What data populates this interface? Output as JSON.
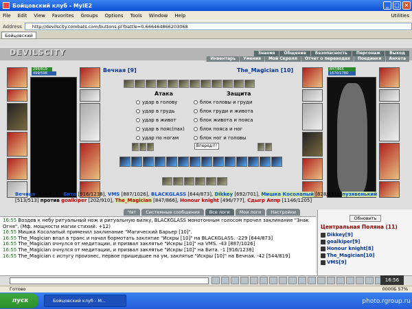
{
  "window": {
    "title": "Бойцовский клуб - MyIE2"
  },
  "menu": {
    "items": [
      "File",
      "Edit",
      "View",
      "Favorites",
      "Groups",
      "Options",
      "Tools",
      "Window",
      "Help"
    ],
    "utilities": "Utilities"
  },
  "address": {
    "label": "Address",
    "url": "http://devilscity.combats.com/buttons.pl?battle=0.666464866203068"
  },
  "tab": {
    "label": "Бойцовский"
  },
  "game": {
    "logo": "DEVILSCITY",
    "nav_top": [
      "Знания",
      "Общение",
      "Безопасность",
      "Персонаж",
      "Выход"
    ],
    "nav_bottom": [
      "Инвентарь",
      "Умения",
      "Мой Скролл",
      "Отчет о переводах",
      "Поединки",
      "Анкета"
    ],
    "left": {
      "name": "Вечная [9]",
      "hp": "294/819",
      "mana": "499/598"
    },
    "right": {
      "name": "The_Magician [10]",
      "hp": "847/866",
      "mana": "1670/1780"
    },
    "attack_header": "Атака",
    "defense_header": "Защита",
    "attacks": [
      "удар в голову",
      "удар в грудь",
      "удар в живот",
      "удар в пояс(пах)",
      "удар по ногам"
    ],
    "defenses": [
      "блок головы и груди",
      "блок груди и живота",
      "блок живота и пояса",
      "блок пояса и ног",
      "блок ног и головы"
    ],
    "forward": "Вперед!!!"
  },
  "teams": {
    "left": [
      {
        "name": "Вечная",
        "hp": "[544/819]"
      },
      {
        "name": "Бита",
        "hp": "[916/1238]"
      },
      {
        "name": "VMS",
        "hp": "[887/1026]"
      },
      {
        "name": "BLACKGLASS",
        "hp": "[644/873]"
      },
      {
        "name": "Dikkey",
        "hp": "[692/701]"
      },
      {
        "name": "Мишка Косолапый",
        "hp": "[828/851]"
      },
      {
        "name": "пузявенький",
        "hp": "[513/513]"
      }
    ],
    "vs": "против",
    "right": [
      {
        "name": "goalkiper",
        "hp": "[202/910]"
      },
      {
        "name": "The_Magician",
        "hp": "[847/866]"
      },
      {
        "name": "Honour knight",
        "hp": "[496/777]"
      },
      {
        "name": "Сдыгр Аппр",
        "hp": "[1146/1205]"
      }
    ]
  },
  "chat_tabs": [
    "Чат",
    "Системные сообщения",
    "Все логи",
    "Мои логи",
    "Настройки"
  ],
  "log": [
    {
      "t": "16:55",
      "text": "Воздев к небу ритуальный нож и ритуальную вилку, BLACKGLASS монотонным голосом прочел заклинание \"Знак Огня\". (Мф. мощности магии стихий: +12)"
    },
    {
      "t": "16:55",
      "text": "Мишка Косолапый применил заклинание \"Магический Барьер [10]\"."
    },
    {
      "t": "16:55",
      "text": "The_Magician впал в транс и начал бормотать заклятие \"Искры [10]\" на BLACKGLASS. -229 [644/873]"
    },
    {
      "t": "16:55",
      "text": "The_Magician очнулся от медитации, и призвал заклятье \"Искры [10]\" на VMS. -43 [887/1026]"
    },
    {
      "t": "16:55",
      "text": "The_Magician очнулся от медитации, и призвал заклятье \"Искры [10]\" на Бита. -1 [916/1238]"
    },
    {
      "t": "16:55",
      "text": "The_Magician с испугу произнес, первое пришедшее на ум, заклятье \"Искры [10]\" на Вечная. -42 [544/819]"
    }
  ],
  "side": {
    "refresh": "Обновить",
    "location": "Центральная Поляна (11)",
    "players": [
      "Dikkey[9]",
      "goalkiper[9]",
      "Honour knight[8]",
      "The_Magician[10]",
      "VMS[9]"
    ]
  },
  "clock": "16:56",
  "status": {
    "left": "Готово",
    "right": "0000Б 57%"
  },
  "taskbar": {
    "start": "пуск",
    "task": "Бойцовский клуб - M...",
    "watermark": "photo.rgroup.ru"
  }
}
